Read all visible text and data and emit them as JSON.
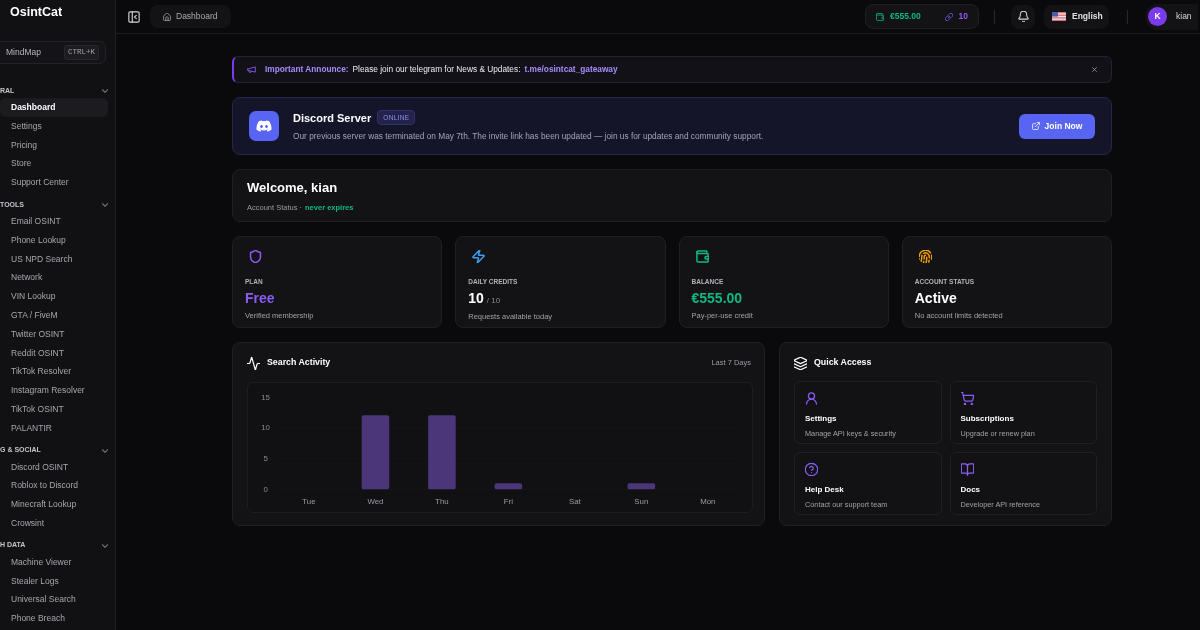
{
  "sidebar": {
    "logo": "OsintCat",
    "mindmap": {
      "label": "MindMap",
      "shortcut": "CTRL+K"
    },
    "sections": [
      {
        "heading": "RAL",
        "expanded": true,
        "items": [
          {
            "label": "Dashboard",
            "selected": true
          },
          {
            "label": "Settings",
            "selected": false
          },
          {
            "label": "Pricing",
            "selected": false
          },
          {
            "label": "Store",
            "selected": false
          },
          {
            "label": "Support Center",
            "selected": false
          }
        ]
      },
      {
        "heading": "TOOLS",
        "expanded": true,
        "items": [
          {
            "label": "Email OSINT",
            "selected": false
          },
          {
            "label": "Phone Lookup",
            "selected": false
          },
          {
            "label": "US NPD Search",
            "selected": false
          },
          {
            "label": "Network",
            "selected": false
          },
          {
            "label": "VIN Lookup",
            "selected": false
          },
          {
            "label": "GTA / FiveM",
            "selected": false
          },
          {
            "label": "Twitter OSINT",
            "selected": false
          },
          {
            "label": "Reddit OSINT",
            "selected": false
          },
          {
            "label": "TikTok Resolver",
            "selected": false
          },
          {
            "label": "Instagram Resolver",
            "selected": false
          },
          {
            "label": "TikTok OSINT",
            "selected": false
          },
          {
            "label": "PALANTIR",
            "selected": false
          }
        ]
      },
      {
        "heading": "G & SOCIAL",
        "expanded": true,
        "items": [
          {
            "label": "Discord OSINT",
            "selected": false
          },
          {
            "label": "Roblox to Discord",
            "selected": false
          },
          {
            "label": "Minecraft Lookup",
            "selected": false
          },
          {
            "label": "Crowsint",
            "selected": false
          }
        ]
      },
      {
        "heading": "H DATA",
        "expanded": true,
        "items": [
          {
            "label": "Machine Viewer",
            "selected": false
          },
          {
            "label": "Stealer Logs",
            "selected": false
          },
          {
            "label": "Universal Search",
            "selected": false
          },
          {
            "label": "Phone Breach",
            "selected": false
          }
        ]
      }
    ]
  },
  "topbar": {
    "breadcrumb": "Dashboard",
    "balance": "€555.00",
    "credits": "10",
    "language": "English",
    "user": {
      "initial": "K",
      "name": "kian"
    }
  },
  "announcement": {
    "label": "Important Announce:",
    "message": "Please join our telegram for News & Updates:",
    "link": "t.me/osintcat_gateaway"
  },
  "discord": {
    "title": "Discord Server",
    "badge": "ONLINE",
    "description": "Our previous server was terminated on May 7th. The invite link has been updated — join us for updates and community support.",
    "button": "Join Now"
  },
  "welcome": {
    "title": "Welcome, kian",
    "status_label": "Account Status ·",
    "status_value": "never expires"
  },
  "stats": [
    {
      "label": "PLAN",
      "value": "Free",
      "description": "Verified membership",
      "color": "#8b5cf6",
      "value_tinted": true
    },
    {
      "label": "DAILY CREDITS",
      "value": "10",
      "value_suffix": "/ 10",
      "description": "Requests available today",
      "color": "#3b9ded",
      "value_tinted": false
    },
    {
      "label": "BALANCE",
      "value": "€555.00",
      "description": "Pay-per-use credit",
      "color": "#10b981",
      "value_tinted": true
    },
    {
      "label": "ACCOUNT STATUS",
      "value": "Active",
      "description": "No account limits detected",
      "color": "#f59e0b",
      "value_tinted": false
    }
  ],
  "search_activity": {
    "title": "Search Activity",
    "range": "Last 7 Days",
    "chart_data": {
      "type": "bar",
      "categories": [
        "Tue",
        "Wed",
        "Thu",
        "Fri",
        "Sat",
        "Sun",
        "Mon"
      ],
      "values": [
        0,
        12,
        12,
        1,
        0,
        1,
        0
      ],
      "ylim": [
        0,
        15
      ],
      "yticks": [
        0,
        5,
        10,
        15
      ]
    }
  },
  "quick_access": {
    "title": "Quick Access",
    "items": [
      {
        "title": "Settings",
        "description": "Manage API keys & security"
      },
      {
        "title": "Subscriptions",
        "description": "Upgrade or renew plan"
      },
      {
        "title": "Help Desk",
        "description": "Contact our support team"
      },
      {
        "title": "Docs",
        "description": "Developer API reference"
      }
    ]
  }
}
